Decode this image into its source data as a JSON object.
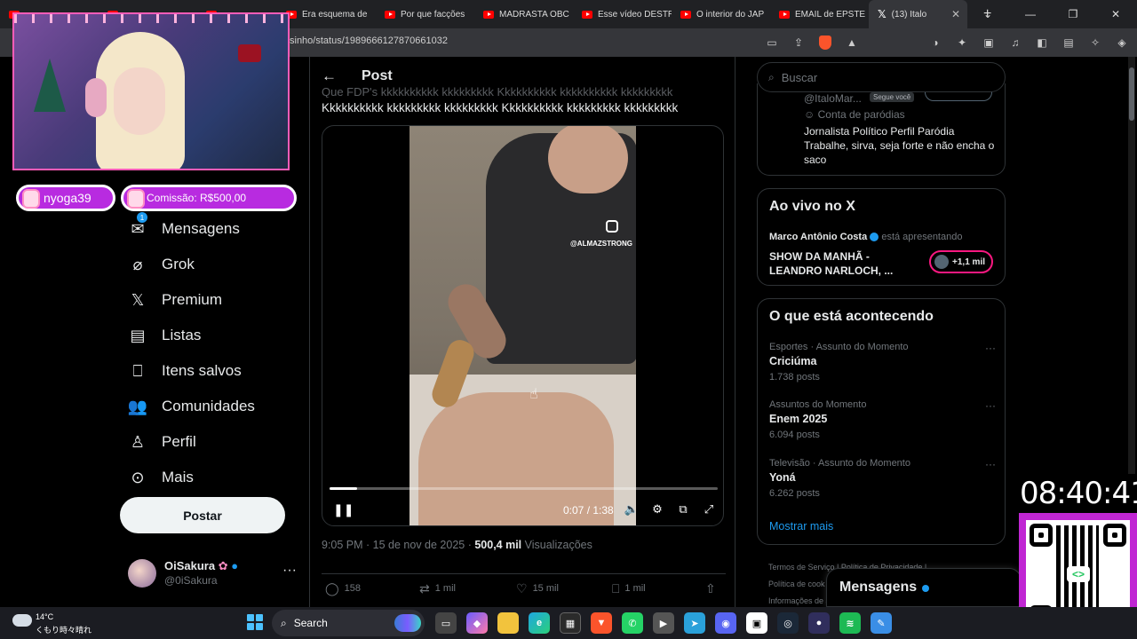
{
  "browser": {
    "tabs": [
      {
        "label": "",
        "icon": "youtube-icon"
      },
      {
        "label": "",
        "icon": "youtube-icon"
      },
      {
        "label": "",
        "icon": "youtube-icon"
      },
      {
        "label": "Era esquema de",
        "icon": "youtube-icon"
      },
      {
        "label": "Por que facções",
        "icon": "youtube-icon"
      },
      {
        "label": "MADRASTA OBC",
        "icon": "youtube-icon"
      },
      {
        "label": "Esse vídeo DESTR",
        "icon": "youtube-icon"
      },
      {
        "label": "O interior do JAP",
        "icon": "youtube-icon"
      },
      {
        "label": "EMAIL de EPSTE",
        "icon": "youtube-icon"
      },
      {
        "label": "(13) Italo",
        "icon": "x-icon",
        "active": true
      }
    ],
    "url": "sinho/status/1989666127870661032"
  },
  "stream_overlay": {
    "chat": [
      {
        "text": "nyoga39"
      },
      {
        "text": "Comissão: R$500,00"
      }
    ],
    "clock": "08:40:41"
  },
  "nav": {
    "items": [
      {
        "label": "Mensagens",
        "icon": "mail-icon",
        "badge": "1"
      },
      {
        "label": "Grok",
        "icon": "grok-icon"
      },
      {
        "label": "Premium",
        "icon": "x-logo-icon"
      },
      {
        "label": "Listas",
        "icon": "list-icon"
      },
      {
        "label": "Itens salvos",
        "icon": "bookmark-icon"
      },
      {
        "label": "Comunidades",
        "icon": "people-icon"
      },
      {
        "label": "Perfil",
        "icon": "person-icon"
      },
      {
        "label": "Mais",
        "icon": "more-circle-icon"
      }
    ],
    "post_button": "Postar",
    "account": {
      "name": "OiSakura",
      "handle": "@0iSakura"
    }
  },
  "post": {
    "header_title": "Post",
    "faded_line": "Que FDP's kkkkkkkkkk kkkkkkkkk Kkkkkkkkkk kkkkkkkkkk kkkkkkkkk",
    "text": "Kkkkkkkkkk kkkkkkkkk kkkkkkkkk Kkkkkkkkkk kkkkkkkkk kkkkkkkkk",
    "video": {
      "watermark": "@ALMAZSTRONG",
      "time": "0:07 / 1:38",
      "progress": 0.071
    },
    "meta": {
      "datetime": "9:05 PM · 15 de nov de 2025 · ",
      "views": "500,4 mil",
      "views_label": " Visualizações"
    },
    "actions": {
      "replies": "158",
      "reposts": "1 mil",
      "likes": "15 mil",
      "bookmarks": "1 mil"
    }
  },
  "sidebar": {
    "search_placeholder": "Buscar",
    "profile_card": {
      "handle": "@ItaloMar...",
      "follows_you": "Segue você",
      "parody_label": "Conta de paródias",
      "bio": "Jornalista Político Perfil Paródia Trabalhe, sirva, seja forte e não encha o saco"
    },
    "live": {
      "title": "Ao vivo no X",
      "host": "Marco Antônio Costa",
      "host_suffix": " está apresentando",
      "show": "SHOW DA MANHÃ - LEANDRO NARLOCH, ...",
      "listeners": "+1,1 mil"
    },
    "trends": {
      "title": "O que está acontecendo",
      "items": [
        {
          "category": "Esportes · Assunto do Momento",
          "name": "Criciúma",
          "count": "1.738 posts"
        },
        {
          "category": "Assuntos do Momento",
          "name": "Enem 2025",
          "count": "6.094 posts"
        },
        {
          "category": "Televisão · Assunto do Momento",
          "name": "Yoná",
          "count": "6.262 posts"
        }
      ],
      "show_more": "Mostrar mais"
    },
    "footer": {
      "line1": "Termos de Serviço  |  Política de Privacidade  |",
      "line2": "Política de cook",
      "line3": "Informações de a"
    },
    "messages_drawer": "Mensagens"
  },
  "taskbar": {
    "temp": "14°C",
    "weather": "くもり時々晴れ",
    "search": "Search",
    "apps": [
      "task-view-icon",
      "copilot-icon",
      "folder-icon",
      "edge-icon",
      "store-icon",
      "brave-icon",
      "whatsapp-icon",
      "video-icon",
      "telegram-icon",
      "discord-icon",
      "app-icon",
      "steam-icon",
      "obs-icon",
      "spotify-icon",
      "paint-icon"
    ]
  },
  "colors": {
    "accent": "#1d9bf0",
    "live_ring": "#f91880",
    "overlay_pink": "#b82be0",
    "qr_frame": "#c026d3"
  }
}
